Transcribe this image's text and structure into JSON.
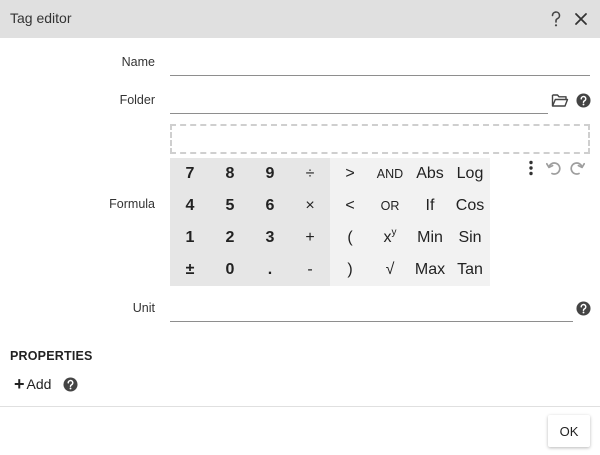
{
  "dialog": {
    "title": "Tag editor"
  },
  "fields": {
    "name_label": "Name",
    "name_value": "",
    "folder_label": "Folder",
    "folder_value": "",
    "formula_label": "Formula",
    "formula_value": "",
    "unit_label": "Unit",
    "unit_value": ""
  },
  "keypad": {
    "rows": [
      [
        "7",
        "8",
        "9",
        "÷",
        ">",
        "AND",
        "Abs",
        "Log"
      ],
      [
        "4",
        "5",
        "6",
        "×",
        "<",
        "OR",
        "If",
        "Cos"
      ],
      [
        "1",
        "2",
        "3",
        "+",
        "(",
        "x",
        "Min",
        "Sin"
      ],
      [
        "±",
        "0",
        ".",
        "-",
        ")",
        "√",
        "Max",
        "Tan"
      ]
    ],
    "power_superscript": "y"
  },
  "properties": {
    "title": "PROPERTIES",
    "add_label": "Add"
  },
  "footer": {
    "ok_label": "OK"
  },
  "colors": {
    "titlebar": "#e0e0e0",
    "key_number_bg": "#e6e6e6",
    "key_operator_bg": "#f2f2f2",
    "icon": "#555555",
    "icon_disabled": "#9e9e9e"
  }
}
